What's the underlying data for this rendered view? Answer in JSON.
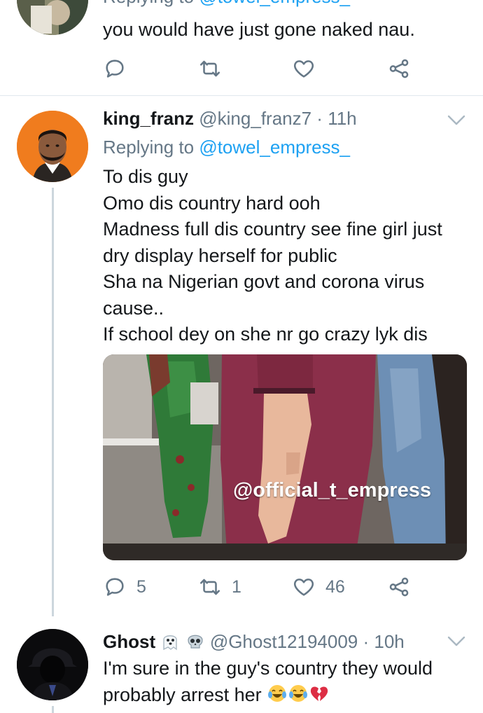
{
  "tweet_prev": {
    "reply_to_prefix": "Replying to ",
    "reply_to_handle": "@towel_empress_",
    "text": "you would have just gone naked nau."
  },
  "tweet_main": {
    "display_name": "king_franz",
    "handle": "@king_franz7",
    "separator": " · ",
    "time": "11h",
    "reply_to_prefix": "Replying to ",
    "reply_to_handle": "@towel_empress_",
    "lines": [
      "To dis guy",
      "Omo dis country hard ooh",
      "Madness full dis country see fine girl just",
      "dry display herself for public",
      "Sha na Nigerian govt and corona virus",
      "cause..",
      "If school dey on she nr go crazy lyk dis"
    ],
    "media_watermark": "@official_t_empress",
    "reply_count": "5",
    "retweet_count": "1",
    "like_count": "46"
  },
  "tweet_next": {
    "display_name": "Ghost",
    "handle": "@Ghost12194009",
    "separator": " · ",
    "time": "10h",
    "name_emojis": [
      "ghost-emoji",
      "skull-emoji"
    ],
    "line1": "I'm sure in the guy's country they would",
    "line2": "probably arrest her",
    "trailing_emojis": [
      "tears-of-joy-emoji",
      "tears-of-joy-emoji",
      "broken-heart-emoji"
    ]
  },
  "colors": {
    "link": "#1da1f2",
    "secondary": "#657786",
    "divider": "#e1e8ed",
    "thread_line": "#ccd6dd"
  }
}
